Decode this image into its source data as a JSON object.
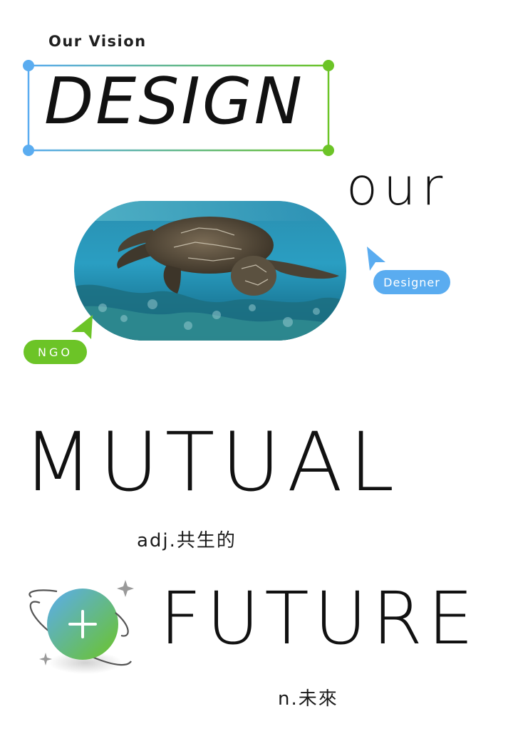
{
  "header": {
    "eyebrow": "Our Vision"
  },
  "hero": {
    "design_word": "DESIGN",
    "our_word": "our",
    "mutual_word": "MUTUAL",
    "mutual_note": "adj.共生的",
    "future_word": "FUTURE",
    "future_note": "n.未來"
  },
  "tags": {
    "designer": "Designer",
    "ngo": "NGO"
  },
  "icons": {
    "frame_handles": "selection-handle-icon",
    "designer_cursor": "pointer-cursor-icon",
    "ngo_cursor": "pointer-cursor-icon",
    "planet": "planet-plus-icon",
    "sparkle": "sparkle-icon"
  },
  "colors": {
    "blue": "#5aacf0",
    "green": "#6cc427",
    "text": "#111111"
  },
  "image": {
    "subject": "sea-turtle-photo"
  }
}
